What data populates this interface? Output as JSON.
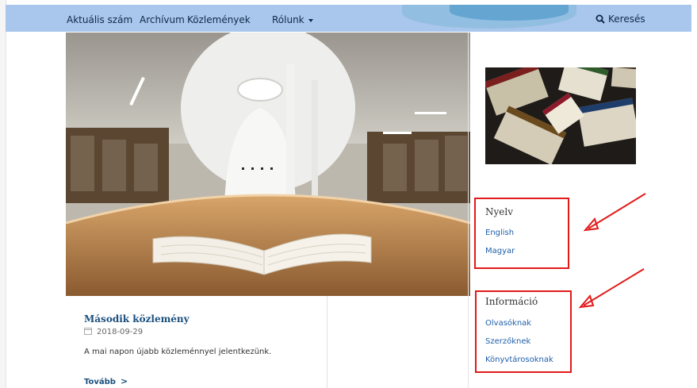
{
  "nav": {
    "items": [
      "Aktuális szám",
      "Archívum",
      "Közlemények",
      "Rólunk"
    ],
    "search_label": "Keresés"
  },
  "article": {
    "title": "Második közlemény",
    "date": "2018-09-29",
    "summary": "A mai napon újabb közleménnyel jelentkezünk.",
    "more_label": "Tovább"
  },
  "sidebar": {
    "language": {
      "title": "Nyelv",
      "links": [
        "English",
        "Magyar"
      ]
    },
    "information": {
      "title": "Információ",
      "links": [
        "Olvasóknak",
        "Szerzőknek",
        "Könyvtárosoknak"
      ]
    }
  },
  "colors": {
    "navbar": "#a9c6ec",
    "link": "#1f5fa8",
    "title": "#1b4f7d",
    "highlight": "#e21a1a"
  },
  "icons": {
    "search": "search-icon",
    "calendar": "calendar-icon",
    "more": "chevron-right-icon",
    "dropdown": "caret-down-icon"
  }
}
